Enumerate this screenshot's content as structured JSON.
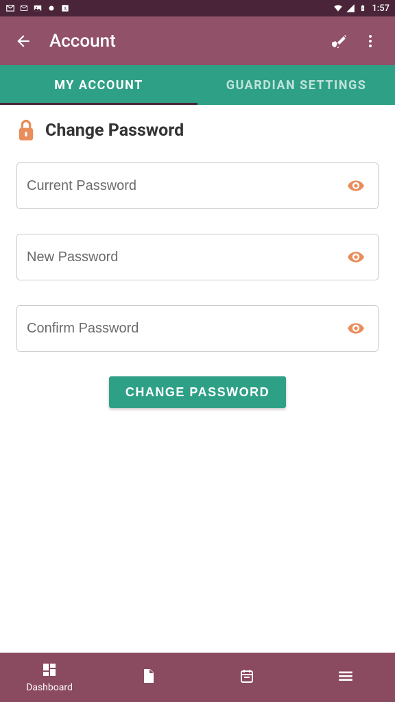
{
  "status": {
    "time": "1:57"
  },
  "header": {
    "title": "Account"
  },
  "tabs": [
    {
      "label": "MY ACCOUNT",
      "active": true
    },
    {
      "label": "GUARDIAN SETTINGS",
      "active": false
    }
  ],
  "section": {
    "title": "Change Password"
  },
  "fields": {
    "current": {
      "placeholder": "Current Password"
    },
    "new": {
      "placeholder": "New Password"
    },
    "confirm": {
      "placeholder": "Confirm Password"
    }
  },
  "submit": {
    "label": "CHANGE PASSWORD"
  },
  "bottom_nav": {
    "items": [
      {
        "label": "Dashboard"
      },
      {
        "label": ""
      },
      {
        "label": ""
      },
      {
        "label": ""
      }
    ]
  },
  "colors": {
    "accent": "#e98d5b",
    "teal": "#2ea086",
    "maroon": "#915168"
  }
}
